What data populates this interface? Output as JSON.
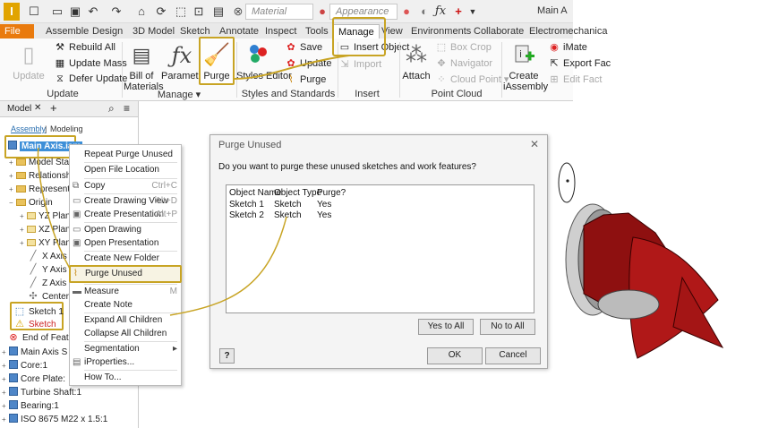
{
  "app": {
    "title_fragment": "Main A"
  },
  "qat": {
    "material_placeholder": "Material",
    "appearance_placeholder": "Appearance"
  },
  "tabs": [
    "File",
    "Assemble",
    "Design",
    "3D Model",
    "Sketch",
    "Annotate",
    "Inspect",
    "Tools",
    "Manage",
    "View",
    "Environments",
    "Collaborate",
    "Electromechanica"
  ],
  "ribbon": {
    "update": "Update",
    "rebuild_all": "Rebuild All",
    "update_mass": "Update Mass",
    "defer_update": "Defer Update",
    "group_update": "Update",
    "bom_line1": "Bill of",
    "bom_line2": "Materials",
    "parameters": "Parameters",
    "purge": "Purge",
    "group_manage": "Manage",
    "styles_editor": "Styles Editor",
    "save": "Save",
    "update2": "Update",
    "purge2": "Purge",
    "group_styles": "Styles and Standards",
    "insert_object": "Insert Object",
    "import": "Import",
    "group_insert": "Insert",
    "attach": "Attach",
    "box_crop": "Box Crop",
    "navigator": "Navigator",
    "cloud_point": "Cloud Point",
    "group_pointcloud": "Point Cloud",
    "create_line1": "Create",
    "create_line2": "iAssembly",
    "imate": "iMate",
    "export_fac": "Export Fac",
    "edit_fact": "Edit Fact"
  },
  "browser": {
    "tab_model": "Model",
    "sub_assembly": "Assembly",
    "sub_modeling": "Modeling",
    "root": "Main Axis.iam",
    "rows": [
      "Model State",
      "Relationship",
      "Representat",
      "Origin",
      "YZ Plane",
      "XZ Plane",
      "XY Plane",
      "X Axis",
      "Y Axis",
      "Z Axis",
      "Center P",
      "Sketch 1",
      "Sketch",
      "End of Feat",
      "Main Axis S",
      "Core:1",
      "Core Plate:",
      "Turbine Shaft:1",
      "Bearing:1",
      "ISO 8675 M22 x 1.5:1"
    ]
  },
  "context_menu": {
    "items": [
      "Repeat Purge Unused",
      "Open File Location",
      "Copy",
      "Create Drawing View",
      "Create Presentation",
      "Open Drawing",
      "Open Presentation",
      "Create New Folder",
      "Purge Unused",
      "Measure",
      "Create Note",
      "Expand All Children",
      "Collapse All Children",
      "Segmentation",
      "iProperties...",
      "How To..."
    ],
    "shortcuts": {
      "copy": "Ctrl+C",
      "drawing": "Alt+D",
      "presentation": "Alt+P",
      "measure": "M"
    }
  },
  "dialog": {
    "title": "Purge Unused",
    "question": "Do you want to purge these unused sketches and work features?",
    "columns": [
      "Object Name",
      "Object Type",
      "Purge?"
    ],
    "rows": [
      {
        "name": "Sketch 1",
        "type": "Sketch",
        "purge": "Yes"
      },
      {
        "name": "Sketch 2",
        "type": "Sketch",
        "purge": "Yes"
      }
    ],
    "yes_to_all": "Yes to All",
    "no_to_all": "No to All",
    "ok": "OK",
    "cancel": "Cancel",
    "help": "?",
    "close": "✕"
  },
  "colors": {
    "accent": "#c8a424",
    "file_tab": "#e97a0d",
    "model_red": "#9c1414"
  }
}
